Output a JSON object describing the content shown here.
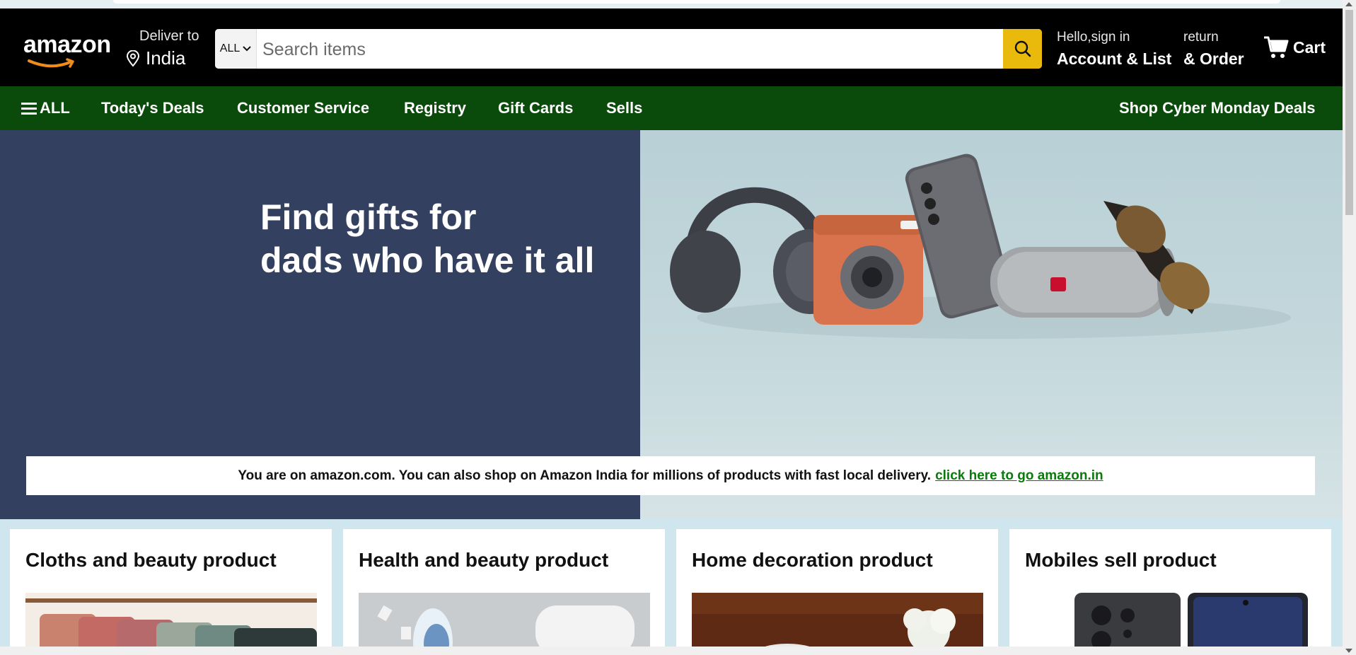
{
  "header": {
    "logo_text": "amazon",
    "deliver_label": "Deliver to",
    "deliver_location": "India",
    "search": {
      "category": "ALL",
      "placeholder": "Search items"
    },
    "signin": {
      "line1": "Hello,sign in",
      "line2": "Account & List"
    },
    "returns": {
      "line1": "return",
      "line2": "& Order"
    },
    "cart_label": "Cart"
  },
  "nav": {
    "all_label": "ALL",
    "items": [
      "Today's Deals",
      "Customer Service",
      "Registry",
      "Gift Cards",
      "Sells"
    ],
    "promo": "Shop Cyber Monday Deals"
  },
  "hero": {
    "title_line1": "Find gifts for",
    "title_line2": "dads who have it all",
    "colors": {
      "left_bg": "#34405f"
    }
  },
  "notice": {
    "text": "You are on amazon.com. You can also shop on Amazon India for millions of products with fast local delivery.",
    "link": "click here to go amazon.in"
  },
  "cards": [
    {
      "title": "Cloths and beauty product"
    },
    {
      "title": "Health and beauty product"
    },
    {
      "title": "Home decoration product"
    },
    {
      "title": "Mobiles sell product"
    }
  ],
  "colors": {
    "header_bg": "#000000",
    "nav_bg": "#0a4a0a",
    "search_button": "#e9b90b",
    "link_green": "#0a7a0a"
  }
}
